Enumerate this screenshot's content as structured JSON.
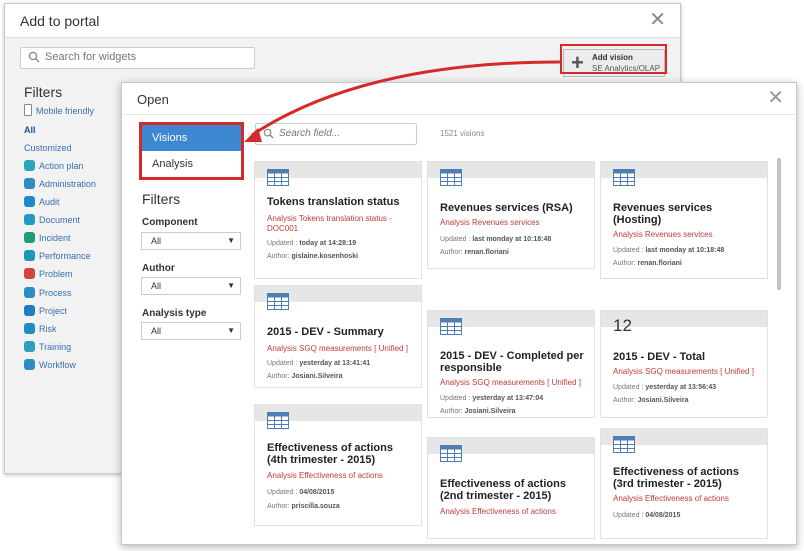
{
  "portal": {
    "title": "Add to portal",
    "close_glyph": "✕",
    "search_placeholder": "Search for widgets",
    "add_vision": {
      "plus": "+",
      "title": "Add vision",
      "subtitle": "SE Analytics/OLAP"
    },
    "filters_title": "Filters",
    "filter_items": [
      {
        "label": "Mobile friendly",
        "icon": "mobile-icon",
        "color": "#8a8a8a"
      },
      {
        "label": "All",
        "icon": "",
        "color": ""
      },
      {
        "label": "Customized",
        "icon": "",
        "color": ""
      },
      {
        "label": "Action plan",
        "icon": "action-plan-icon",
        "color": "#2ba5b8"
      },
      {
        "label": "Administration",
        "icon": "administration-icon",
        "color": "#2b8fc2"
      },
      {
        "label": "Audit",
        "icon": "audit-icon",
        "color": "#1f89c9"
      },
      {
        "label": "Document",
        "icon": "document-icon",
        "color": "#2798c4"
      },
      {
        "label": "Incident",
        "icon": "incident-icon",
        "color": "#1f9e76"
      },
      {
        "label": "Performance",
        "icon": "performance-icon",
        "color": "#1f97b6"
      },
      {
        "label": "Problem",
        "icon": "problem-icon",
        "color": "#d2453a"
      },
      {
        "label": "Process",
        "icon": "process-icon",
        "color": "#2b8fc2"
      },
      {
        "label": "Project",
        "icon": "project-icon",
        "color": "#1d7ec4"
      },
      {
        "label": "Risk",
        "icon": "risk-icon",
        "color": "#1e8fc4"
      },
      {
        "label": "Training",
        "icon": "training-icon",
        "color": "#2aa0bf"
      },
      {
        "label": "Workflow",
        "icon": "workflow-icon",
        "color": "#2b8fc2"
      }
    ]
  },
  "open": {
    "title": "Open",
    "close_glyph": "✕",
    "modes": [
      "Visions",
      "Analysis"
    ],
    "filters_title": "Filters",
    "filters": [
      {
        "label": "Component",
        "value": "All"
      },
      {
        "label": "Author",
        "value": "All"
      },
      {
        "label": "Analysis type",
        "value": "All"
      }
    ],
    "search_placeholder": "Search field...",
    "count": "1521 visions",
    "cards": [
      {
        "title": "Tokens translation status",
        "analysis": "Analysis Tokens translation status - DOC001",
        "updated_label": "Updated : ",
        "updated": "today at 14:28:19",
        "author_label": "Author: ",
        "author": "gislaine.kosenhoski",
        "icon": "table-icon"
      },
      {
        "title": "Revenues services (RSA)",
        "analysis": "Analysis Revenues services",
        "updated_label": "Updated : ",
        "updated": "last monday at 10:18:48",
        "author_label": "Author: ",
        "author": "renan.floriani",
        "icon": "table-icon"
      },
      {
        "title": "Revenues services (Hosting)",
        "analysis": "Analysis Revenues services",
        "updated_label": "Updated : ",
        "updated": "last monday at 10:18:48",
        "author_label": "Author: ",
        "author": "renan.floriani",
        "icon": "table-icon"
      },
      {
        "title": "2015 - DEV - Summary",
        "analysis": "Analysis SGQ measurements [ Unified ]",
        "updated_label": "Updated : ",
        "updated": "yesterday at 13:41:41",
        "author_label": "Author: ",
        "author": "Josiani.Silveira",
        "icon": "table-icon"
      },
      {
        "title": "2015 - DEV - Completed per responsible",
        "analysis": "Analysis SGQ measurements [ Unified ]",
        "updated_label": "Updated : ",
        "updated": "yesterday at 13:47:04",
        "author_label": "Author: ",
        "author": "Josiani.Silveira",
        "icon": "table-icon"
      },
      {
        "title": "2015 - DEV - Total",
        "number": "12",
        "analysis": "Analysis SGQ measurements [ Unified ]",
        "updated_label": "Updated : ",
        "updated": "yesterday at 13:56:43",
        "author_label": "Author: ",
        "author": "Josiani.Silveira",
        "icon": ""
      },
      {
        "title": "Effectiveness of actions (4th trimester - 2015)",
        "analysis": "Analysis Effectiveness of actions",
        "updated_label": "Updated : ",
        "updated": "04/08/2015",
        "author_label": "Author: ",
        "author": "priscilla.souza",
        "icon": "table-icon"
      },
      {
        "title": "Effectiveness of actions (2nd trimester - 2015)",
        "analysis": "Analysis Effectiveness of actions",
        "icon": "table-icon"
      },
      {
        "title": "Effectiveness of actions (3rd trimester - 2015)",
        "analysis": "Analysis Effectiveness of actions",
        "updated_label": "Updated : ",
        "updated": "04/08/2015",
        "icon": "table-icon"
      }
    ]
  },
  "accent": {
    "highlight": "#d42a2a",
    "active_tab": "#3d88d1",
    "analysis_text": "#c23b3b"
  }
}
